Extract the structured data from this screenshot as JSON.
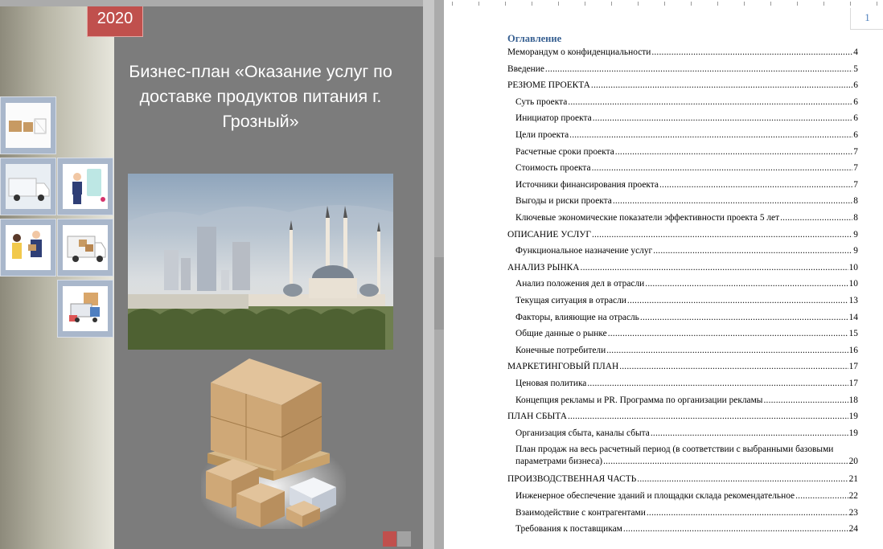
{
  "cover": {
    "year": "2020",
    "title": "Бизнес-план «Оказание услуг по доставке продуктов питания г. Грозный»"
  },
  "page_number": "1",
  "toc": {
    "heading": "Оглавление",
    "entries": [
      {
        "label": "Меморандум о конфиденциальности",
        "page": "4",
        "level": 1
      },
      {
        "label": "Введение",
        "page": "5",
        "level": 1
      },
      {
        "label": "РЕЗЮМЕ ПРОЕКТА",
        "page": "6",
        "level": 1
      },
      {
        "label": "Суть проекта",
        "page": "6",
        "level": 2
      },
      {
        "label": "Инициатор проекта",
        "page": "6",
        "level": 2
      },
      {
        "label": "Цели проекта",
        "page": "6",
        "level": 2
      },
      {
        "label": "Расчетные сроки проекта",
        "page": "7",
        "level": 2
      },
      {
        "label": "Стоимость проекта",
        "page": "7",
        "level": 2
      },
      {
        "label": "Источники финансирования проекта",
        "page": "7",
        "level": 2
      },
      {
        "label": "Выгоды и риски проекта",
        "page": "8",
        "level": 2
      },
      {
        "label": "Ключевые экономические показатели эффективности проекта 5 лет",
        "page": "8",
        "level": 2
      },
      {
        "label": "ОПИСАНИЕ УСЛУГ",
        "page": "9",
        "level": 1
      },
      {
        "label": "Функциональное назначение услуг",
        "page": "9",
        "level": 2
      },
      {
        "label": "АНАЛИЗ РЫНКА",
        "page": "10",
        "level": 1
      },
      {
        "label": "Анализ положения дел в отрасли",
        "page": "10",
        "level": 2
      },
      {
        "label": "Текущая ситуация в отрасли",
        "page": "13",
        "level": 2
      },
      {
        "label": "Факторы, влияющие на отрасль",
        "page": "14",
        "level": 2
      },
      {
        "label": "Общие данные о рынке",
        "page": "15",
        "level": 2
      },
      {
        "label": "Конечные потребители",
        "page": "16",
        "level": 2
      },
      {
        "label": "МАРКЕТИНГОВЫЙ ПЛАН",
        "page": "17",
        "level": 1
      },
      {
        "label": "Ценовая политика",
        "page": "17",
        "level": 2
      },
      {
        "label": "Концепция рекламы и PR. Программа по организации рекламы",
        "page": "18",
        "level": 2
      },
      {
        "label": "ПЛАН СБЫТА",
        "page": "19",
        "level": 1
      },
      {
        "label": "Организация сбыта, каналы сбыта",
        "page": "19",
        "level": 2
      },
      {
        "label": "План продаж на весь расчетный период (в соответствии с выбранными базовыми",
        "label2": "параметрами бизнеса)",
        "page": "20",
        "level": 2
      },
      {
        "label": "ПРОИЗВОДСТВЕННАЯ ЧАСТЬ",
        "page": "21",
        "level": 1
      },
      {
        "label": "Инженерное обеспечение зданий и площадки склада рекомендательное",
        "page": "22",
        "level": 2
      },
      {
        "label": "Взаимодействие с контрагентами",
        "page": "23",
        "level": 2
      },
      {
        "label": "Требования к поставщикам",
        "page": "24",
        "level": 2
      }
    ]
  }
}
